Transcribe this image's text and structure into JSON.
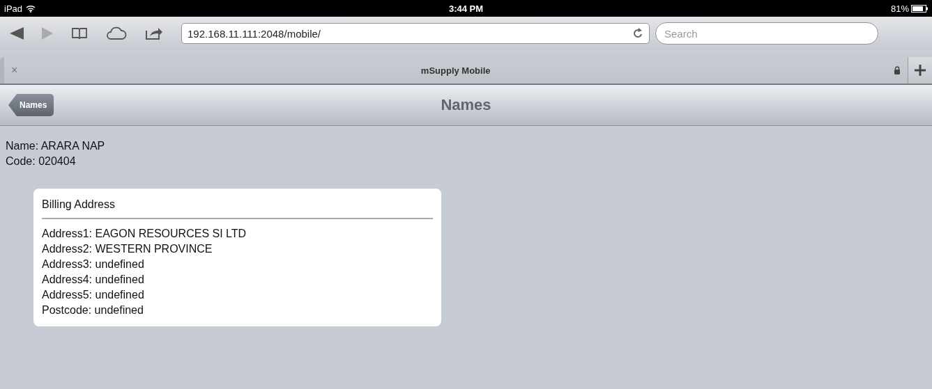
{
  "status_bar": {
    "device": "iPad",
    "time": "3:44 PM",
    "battery": "81%"
  },
  "toolbar": {
    "url": "192.168.11.111:2048/mobile/",
    "search": {
      "placeholder": "Search"
    }
  },
  "tabs": [
    {
      "title": "mSupply Mobile",
      "close": "×"
    }
  ],
  "nav_bar": {
    "back": "Names",
    "title": "Names"
  },
  "details": [
    "Name: ARARA NAP",
    "Code: 020404"
  ],
  "card": {
    "title": "Billing Address",
    "lines": [
      "Address1: EAGON RESOURCES SI LTD",
      "Address2: WESTERN PROVINCE",
      "Address3: undefined",
      "Address4: undefined",
      "Address5: undefined",
      "Postcode: undefined"
    ]
  }
}
